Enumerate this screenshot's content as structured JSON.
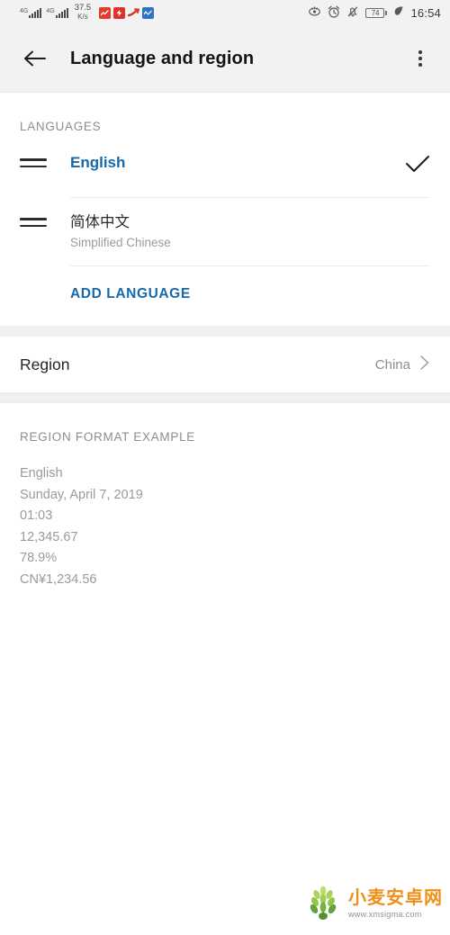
{
  "status_bar": {
    "network_type_1": "4G",
    "network_type_2": "4G",
    "net_speed_value": "37.5",
    "net_speed_unit": "K/s",
    "notification_icons": [
      "stock-app-icon",
      "alert-app-icon",
      "trend-app-icon",
      "chart-app-icon"
    ],
    "right_icons": [
      "eye-icon",
      "alarm-icon",
      "bell-muted-icon",
      "battery-icon",
      "power-saving-leaf-icon"
    ],
    "battery_level": "74",
    "time": "16:54"
  },
  "app_bar": {
    "back_icon": "arrow-left-icon",
    "title": "Language and region",
    "overflow_icon": "more-vertical-icon"
  },
  "languages_section": {
    "header": "LANGUAGES",
    "items": [
      {
        "name": "English",
        "subtitle": "",
        "selected": true,
        "drag_handle": "drag-handle-icon",
        "check_icon": "check-icon"
      },
      {
        "name": "简体中文",
        "subtitle": "Simplified Chinese",
        "selected": false,
        "drag_handle": "drag-handle-icon",
        "check_icon": ""
      }
    ],
    "add_language_label": "ADD LANGUAGE"
  },
  "region_section": {
    "label": "Region",
    "value": "China",
    "chevron_icon": "chevron-right-icon"
  },
  "format_section": {
    "header": "REGION FORMAT EXAMPLE",
    "lines": [
      "English",
      "Sunday, April 7, 2019",
      "01:03",
      "12,345.67",
      "78.9%",
      "CN¥1,234.56"
    ]
  },
  "watermark": {
    "logo_icon": "wheat-logo-icon",
    "title": "小麦安卓网",
    "url": "www.xmsigma.com"
  },
  "colors": {
    "accent_blue": "#1568aa",
    "bar_background": "#f2f2f2",
    "page_background": "#ffffff",
    "muted_text": "#9a9a9a"
  }
}
